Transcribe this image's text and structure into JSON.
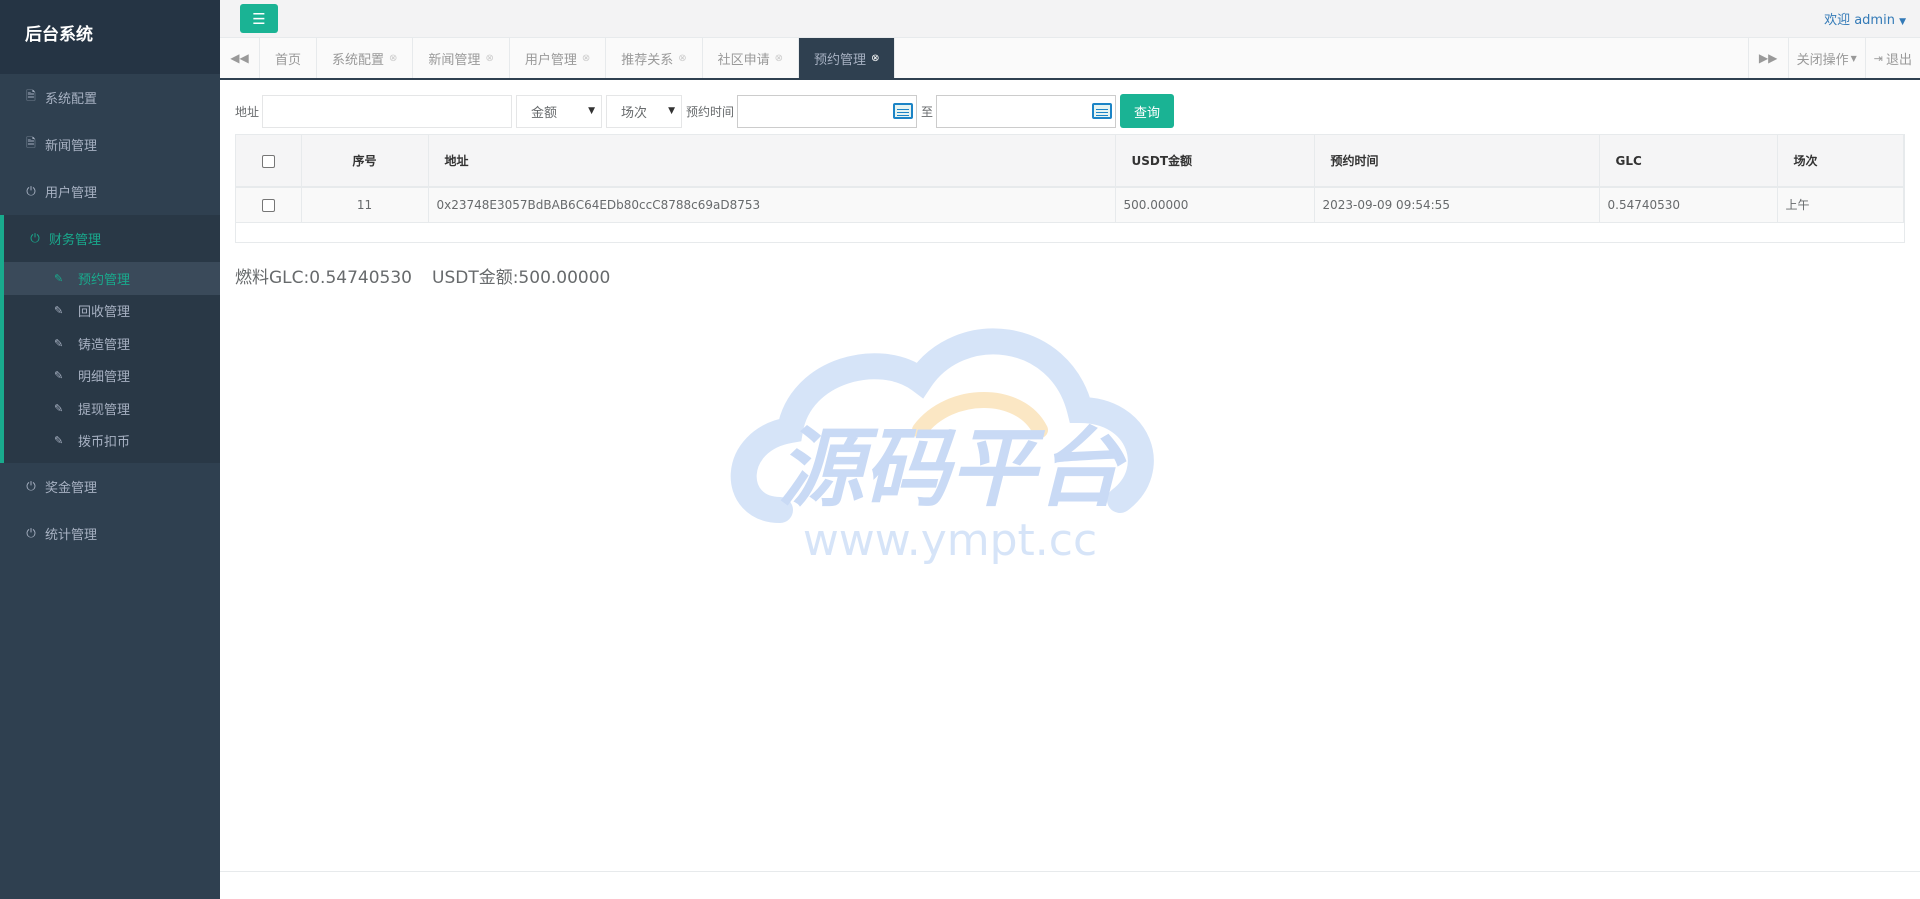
{
  "sidebar": {
    "brand": "后台系统",
    "items": [
      {
        "label": "系统配置",
        "icon": "file-icon"
      },
      {
        "label": "新闻管理",
        "icon": "file-icon"
      },
      {
        "label": "用户管理",
        "icon": "power-icon"
      }
    ],
    "group": {
      "label": "财务管理",
      "icon": "power-icon",
      "sub_items": [
        {
          "label": "预约管理",
          "active": true
        },
        {
          "label": "回收管理"
        },
        {
          "label": "铸造管理"
        },
        {
          "label": "明细管理"
        },
        {
          "label": "提现管理"
        },
        {
          "label": "拨币扣币"
        }
      ]
    },
    "items_after": [
      {
        "label": "奖金管理",
        "icon": "power-icon"
      },
      {
        "label": "统计管理",
        "icon": "power-icon"
      }
    ]
  },
  "header": {
    "welcome": "欢迎 admin"
  },
  "tabs": {
    "items": [
      "首页",
      "系统配置",
      "新闻管理",
      "用户管理",
      "推荐关系",
      "社区申请",
      "预约管理"
    ],
    "active": "预约管理",
    "close_ops": "关闭操作",
    "logout": "退出"
  },
  "filter": {
    "address_label": "地址",
    "amount_select": "金额",
    "session_select": "场次",
    "time_label": "预约时间",
    "to_label": "至",
    "query_button": "查询"
  },
  "table": {
    "headers": [
      "序号",
      "地址",
      "USDT金额",
      "预约时间",
      "GLC",
      "场次"
    ],
    "rows": [
      {
        "id": "11",
        "address": "0x23748E3057BdBAB6C64EDb80ccC8788c69aD8753",
        "usdt": "500.00000",
        "time": "2023-09-09 09:54:55",
        "glc": "0.54740530",
        "session": "上午"
      }
    ]
  },
  "summary": {
    "glc": "燃料GLC:0.54740530",
    "usdt": "USDT金额:500.00000"
  },
  "watermark": {
    "title": "源码平台",
    "url": "www.ympt.cc"
  },
  "colors": {
    "sidebar_bg": "#2f4050",
    "accent": "#1ab394",
    "link": "#337ab7"
  }
}
